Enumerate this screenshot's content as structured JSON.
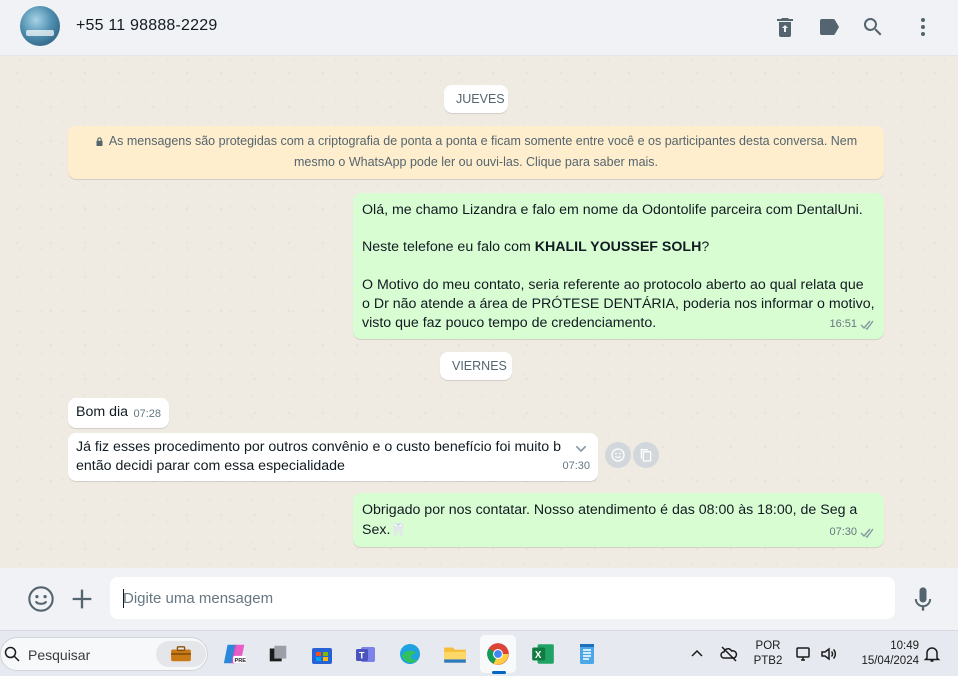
{
  "header": {
    "contact_name": "+55 11 98888-2229",
    "icons": [
      "delete-icon",
      "label-icon",
      "search-icon",
      "menu-icon"
    ]
  },
  "chat": {
    "date_jueves": "JUEVES",
    "encryption_notice": "As mensagens são protegidas com a criptografia de ponta a ponta e ficam somente entre você e os participantes desta conversa. Nem mesmo o WhatsApp pode ler ou ouvi-las. Clique para saber mais.",
    "msg1": {
      "line1": "Olá, me chamo Lizandra e falo em nome da Odontolife parceira com DentalUni.",
      "line2_prefix": "Neste telefone eu falo com ",
      "line2_bold": "KHALIL YOUSSEF SOLH",
      "line2_suffix": "?",
      "line3": "O Motivo do meu contato, seria referente ao protocolo aberto ao qual relata que o Dr não atende a área de PRÓTESE DENTÁRIA, poderia nos informar o motivo, visto que faz pouco tempo de credenciamento.",
      "time": "16:51"
    },
    "date_viernes": "VIERNES",
    "msg2": {
      "text": "Bom dia",
      "time": "07:28"
    },
    "msg3": {
      "text": "Já fiz esses procedimento por outros convênio e o custo benefício foi muito b… então decidi parar com essa especialidade",
      "line1": "Já fiz esses procedimento por outros convênio e o custo benefício foi muito b",
      "line2": "então decidi parar com essa especialidade",
      "time": "07:30"
    },
    "msg4": {
      "text": "Obrigado por nos contatar. Nosso atendimento é das 08:00 às 18:00, de Seg a Sex.",
      "emoji": "🦷",
      "time": "07:30"
    }
  },
  "compose": {
    "placeholder": "Digite uma mensagem",
    "value": ""
  },
  "taskbar": {
    "search_label": "Pesquisar",
    "language_line1": "POR",
    "language_line2": "PTB2",
    "time": "10:49",
    "date": "15/04/2024"
  },
  "colors": {
    "outgoing_bubble": "#d9fdd3",
    "incoming_bubble": "#ffffff",
    "encryption_bg": "#ffeecd",
    "chat_bg": "#efeae2",
    "header_bg": "#f0f2f5"
  }
}
